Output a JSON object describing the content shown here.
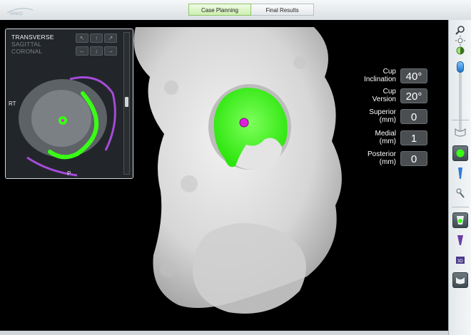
{
  "app": {
    "logo_text": "MAKO"
  },
  "tabs": [
    {
      "label": "Case Planning",
      "active": true
    },
    {
      "label": "Final Results",
      "active": false
    }
  ],
  "inset": {
    "views": [
      {
        "label": "TRANSVERSE",
        "active": true
      },
      {
        "label": "SAGITTAL",
        "active": false
      },
      {
        "label": "CORONAL",
        "active": false
      }
    ],
    "orientation_left": "RT",
    "orientation_bottom": "P",
    "nav_icons": [
      "arrow-up-left-icon",
      "arrow-up-icon",
      "arrow-up-right-icon",
      "arrow-left-icon",
      "arrow-down-icon",
      "arrow-right-icon"
    ]
  },
  "measurements": [
    {
      "label_line1": "Cup",
      "label_line2": "Inclination",
      "value": "40°"
    },
    {
      "label_line1": "Cup",
      "label_line2": "Version",
      "value": "20°"
    },
    {
      "label_line1": "Superior",
      "label_line2": "(mm)",
      "value": "0"
    },
    {
      "label_line1": "Medial",
      "label_line2": "(mm)",
      "value": "1"
    },
    {
      "label_line1": "Posterior",
      "label_line2": "(mm)",
      "value": "0"
    }
  ],
  "toolbar": {
    "icons": [
      "zoom-icon",
      "brightness-icon",
      "contrast-icon",
      "pelvis-view-icon",
      "cup-implant-icon",
      "stem-implant-icon",
      "reduction-icon",
      "cup-plan-icon",
      "femur-plan-icon",
      "3d-view-icon",
      "full-pelvis-icon"
    ],
    "zoom_level": 0.02
  },
  "colors": {
    "implant_green": "#39ff14",
    "center_magenta": "#e01ee0",
    "bone": "#dcdcdc",
    "active_tab": "#cdeeb0"
  }
}
